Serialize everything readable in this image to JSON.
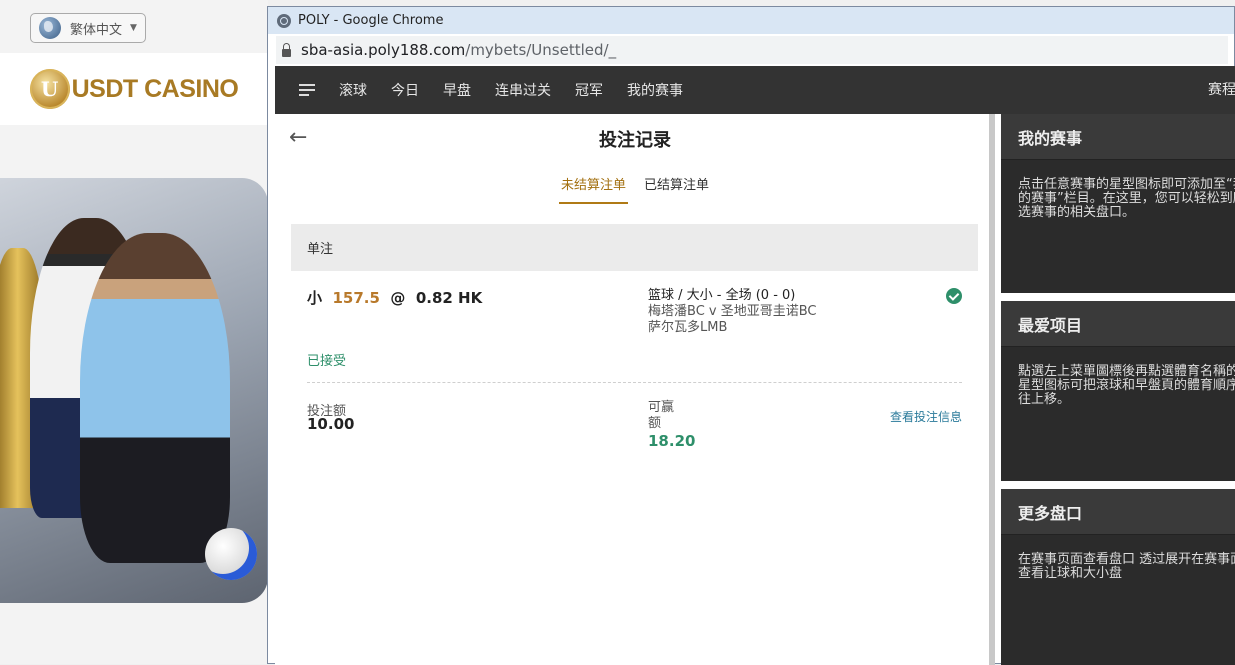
{
  "background_site": {
    "language_label": "繁体中文",
    "logo_text": "USDT CASINO",
    "logo_mark": "U"
  },
  "browser": {
    "window_title": "POLY - Google Chrome",
    "url_host": "sba-asia.poly188.com",
    "url_path": "/mybets/Unsettled/_"
  },
  "nav": {
    "items": [
      "滚球",
      "今日",
      "早盘",
      "连串过关",
      "冠军",
      "我的赛事"
    ],
    "right_label": "赛程"
  },
  "main": {
    "title": "投注记录",
    "tabs": [
      {
        "label": "未结算注单",
        "active": true
      },
      {
        "label": "已结算注单",
        "active": false
      }
    ],
    "section_title": "单注",
    "bet": {
      "selection": "小",
      "line": "157.5",
      "at": "@",
      "odds": "0.82 HK",
      "market": "篮球 / 大小 - 全场 (0 - 0)",
      "match": "梅塔潘BC v 圣地亚哥圭诺BC",
      "league": "萨尔瓦多LMB",
      "status": "已接受",
      "stake_label": "投注额",
      "stake_value": "10.00",
      "win_label": "可赢额",
      "win_value": "18.20",
      "view_link": "查看投注信息"
    }
  },
  "right_panel": {
    "cards": [
      {
        "title": "我的赛事",
        "body": "点击任意赛事的星型图标即可添加至“我的赛事”栏目。在这里，您可以轻松到所选赛事的相关盘口。"
      },
      {
        "title": "最爱项目",
        "body": "點選左上菜單圖標後再點選體育名稱的星型图标可把滾球和早盤頁的體育順序往上移。"
      },
      {
        "title": "更多盘口",
        "body": "在赛事页面查看盘口 透过展开在赛事面查看让球和大小盘"
      }
    ]
  },
  "colors": {
    "accent_gold": "#b07a15",
    "accepted_green": "#2e8f6a",
    "nav_bg": "#333333",
    "card_bg": "#2b2b2b"
  }
}
